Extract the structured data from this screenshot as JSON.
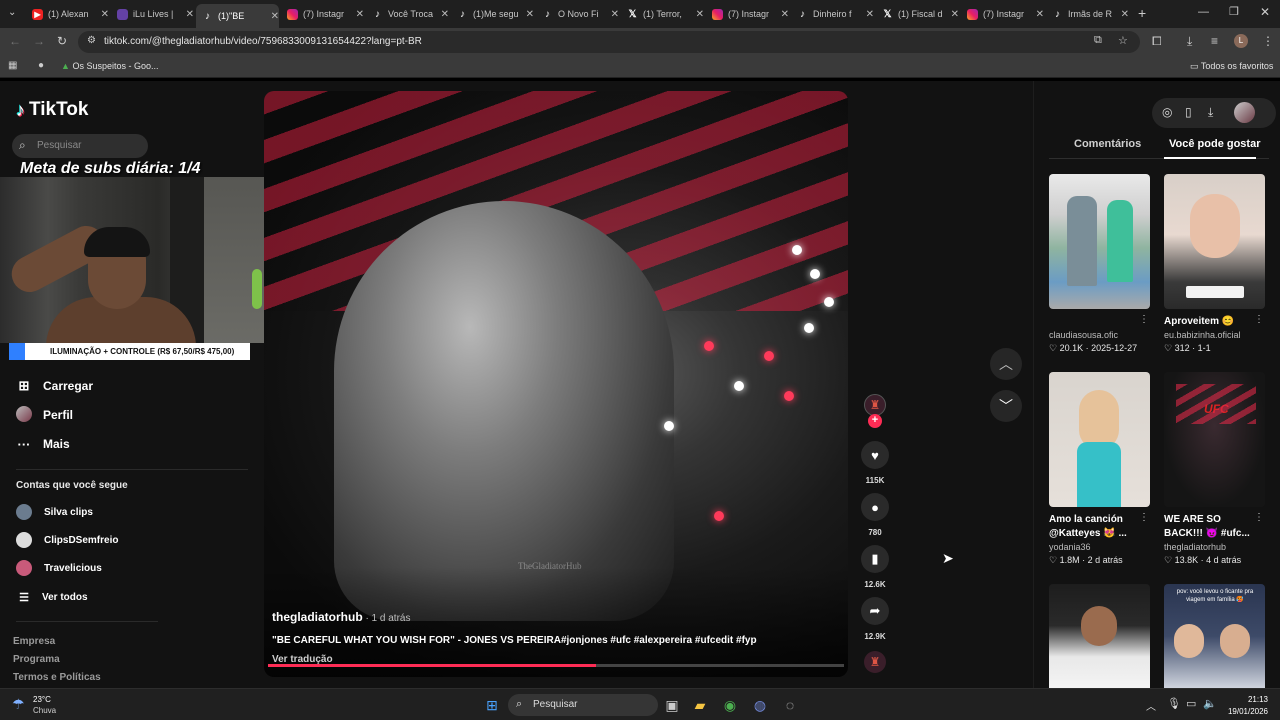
{
  "browser": {
    "tabs": [
      {
        "label": "(1) Alexan",
        "fav": "yt"
      },
      {
        "label": "iLu Lives |",
        "fav": "tw"
      },
      {
        "label": "(1)\"BE",
        "fav": "tt",
        "active": true
      },
      {
        "label": "(7) Instagr",
        "fav": "ig"
      },
      {
        "label": "Você Troca",
        "fav": "tt"
      },
      {
        "label": "(1)Me segu",
        "fav": "tt"
      },
      {
        "label": "O Novo Fi",
        "fav": "tt"
      },
      {
        "label": "(1) Terror,",
        "fav": "x"
      },
      {
        "label": "(7) Instagr",
        "fav": "ig"
      },
      {
        "label": "Dinheiro f",
        "fav": "tt"
      },
      {
        "label": "(1) Fiscal d",
        "fav": "x"
      },
      {
        "label": "(7) Instagr",
        "fav": "ig"
      },
      {
        "label": "Irmãs de R",
        "fav": "tt"
      }
    ],
    "url": "tiktok.com/@thegladiatorhub/video/7596833009131654422?lang=pt-BR",
    "bookmark_item": "Os Suspeitos - Goo...",
    "bookmarks_all": "Todos os favoritos"
  },
  "tiktok": {
    "logo": "TikTok",
    "search_placeholder": "Pesquisar",
    "overlay_goal": "Meta de subs diária: 1/4",
    "overlay_banner": "ILUMINAÇÃO + CONTROLE (R$ 67,50/R$ 475,00)",
    "nav": [
      {
        "label": "Carregar",
        "icon": "plus-square-icon"
      },
      {
        "label": "Perfil",
        "icon": "profile-avatar-icon"
      },
      {
        "label": "Mais",
        "icon": "more-dots-icon"
      }
    ],
    "following_title": "Contas que você segue",
    "following": [
      {
        "name": "Silva clips",
        "color": "#6b7c8f"
      },
      {
        "name": "ClipsDSemfreio",
        "color": "#dddddd"
      },
      {
        "name": "Travelicious",
        "color": "#c85a7a"
      }
    ],
    "see_all": "Ver todos",
    "footer": [
      "Empresa",
      "Programa",
      "Termos e Políticas"
    ],
    "video": {
      "author": "thegladiatorhub",
      "time": " · 1 d atrás",
      "caption": "\"BE CAREFUL WHAT YOU WISH FOR\" - JONES VS PEREIRA#jonjones #ufc #alexpereira #ufcedit #fyp",
      "translate": "Ver tradução",
      "watermark": "TheGladiatorHub",
      "progress": 0.57
    },
    "actions": {
      "likes": "115K",
      "comments": "780",
      "saves": "12.6K",
      "shares": "12.9K"
    },
    "right_tabs": {
      "comments": "Comentários",
      "suggested": "Você pode gostar"
    },
    "suggestions": [
      {
        "title": "",
        "user": "claudiasousa.ofic",
        "likes": "20.1K",
        "date": "2025-12-27"
      },
      {
        "title": "Aproveitem 😊",
        "user": "eu.babizinha.oficial",
        "likes": "312",
        "date": "1-1"
      },
      {
        "title": "Amo la canción",
        "title2": "@Katteyes 😻 ...",
        "user": "yodania36",
        "likes": "1.8M",
        "date": "2 d atrás"
      },
      {
        "title": "WE ARE SO",
        "title2": "BACK!!! 😈 #ufc...",
        "user": "thegladiatorhub",
        "likes": "13.8K",
        "date": "4 d atrás"
      }
    ],
    "thumb_text": "pov: você levou o ficante pra viagem em família 🥵"
  },
  "taskbar": {
    "temp": "23°C",
    "weather": "Chuva",
    "search": "Pesquisar",
    "time": "21:13",
    "date": "19/01/2026"
  }
}
